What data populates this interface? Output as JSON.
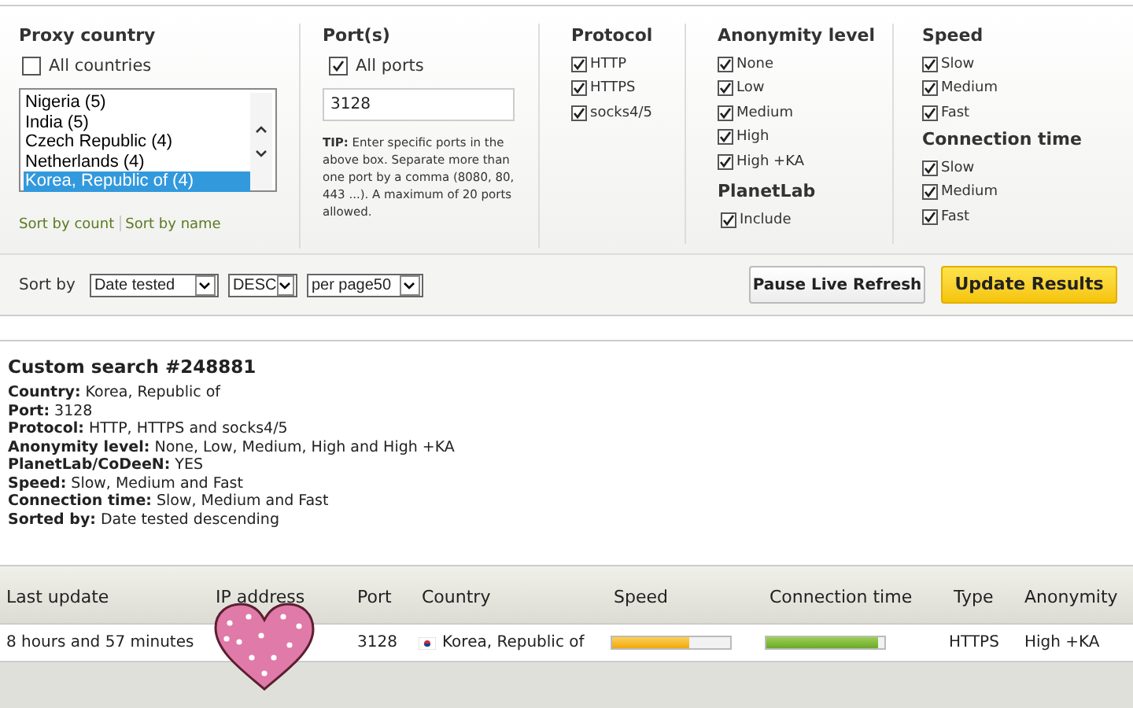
{
  "filters": {
    "country": {
      "title": "Proxy country",
      "all": {
        "label": "All countries",
        "checked": false
      },
      "options": [
        {
          "label": "Nigeria (5)",
          "selected": false
        },
        {
          "label": "India (5)",
          "selected": false
        },
        {
          "label": "Czech Republic (4)",
          "selected": false
        },
        {
          "label": "Netherlands (4)",
          "selected": false
        },
        {
          "label": "Korea, Republic of (4)",
          "selected": true
        }
      ],
      "sort_links": [
        "Sort by count",
        "Sort by name"
      ]
    },
    "ports": {
      "title": "Port(s)",
      "all": {
        "label": "All ports",
        "checked": true
      },
      "value": "3128",
      "tip": "**TIP:** Enter specific ports in the above box. Separate more than one port by a comma (8080, 80, 443 ...). A maximum of 20 ports allowed."
    },
    "protocol": {
      "title": "Protocol",
      "items": [
        {
          "label": "HTTP",
          "checked": true
        },
        {
          "label": "HTTPS",
          "checked": true
        },
        {
          "label": "socks4/5",
          "checked": true
        }
      ]
    },
    "anonymity": {
      "title": "Anonymity level",
      "items": [
        {
          "label": "None",
          "checked": true
        },
        {
          "label": "Low",
          "checked": true
        },
        {
          "label": "Medium",
          "checked": true
        },
        {
          "label": "High",
          "checked": true
        },
        {
          "label": "High +KA",
          "checked": true
        }
      ]
    },
    "planetlab": {
      "title": "PlanetLab",
      "items": [
        {
          "label": "Include",
          "checked": true
        }
      ]
    },
    "speed": {
      "title": "Speed",
      "items": [
        {
          "label": "Slow",
          "checked": true
        },
        {
          "label": "Medium",
          "checked": true
        },
        {
          "label": "Fast",
          "checked": true
        }
      ]
    },
    "connection": {
      "title": "Connection time",
      "items": [
        {
          "label": "Slow",
          "checked": true
        },
        {
          "label": "Medium",
          "checked": true
        },
        {
          "label": "Fast",
          "checked": true
        }
      ]
    }
  },
  "sort_bar": {
    "label": "Sort by",
    "selects": [
      "Date tested",
      "DESC",
      "per page50"
    ],
    "buttons": [
      {
        "label": "Pause Live Refresh",
        "kind": "secondary"
      },
      {
        "label": "Update Results",
        "kind": "primary"
      }
    ]
  },
  "summary": {
    "title": "Custom search #248881",
    "lines": [
      "**Country:** Korea, Republic of",
      "**Port:** 3128",
      "**Protocol:** HTTP, HTTPS and socks4/5",
      "**Anonymity level:** None, Low, Medium, High and High +KA",
      "**PlanetLab/CoDeeN:** YES",
      "**Speed:** Slow, Medium and Fast",
      "**Connection time:** Slow, Medium and Fast",
      "**Sorted by:** Date tested descending"
    ]
  },
  "table": {
    "columns": [
      "Last update",
      "IP address",
      "Port",
      "Country",
      "Speed",
      "Connection time",
      "Type",
      "Anonymity"
    ],
    "rows": [
      {
        "last_update": "8 hours and 57 minutes",
        "port": "3128",
        "country": "Korea, Republic of",
        "speed": {
          "level": 0.65
        },
        "connection_time": {
          "level": 0.95
        },
        "type": "HTTPS",
        "anonymity": "High +KA"
      }
    ]
  }
}
